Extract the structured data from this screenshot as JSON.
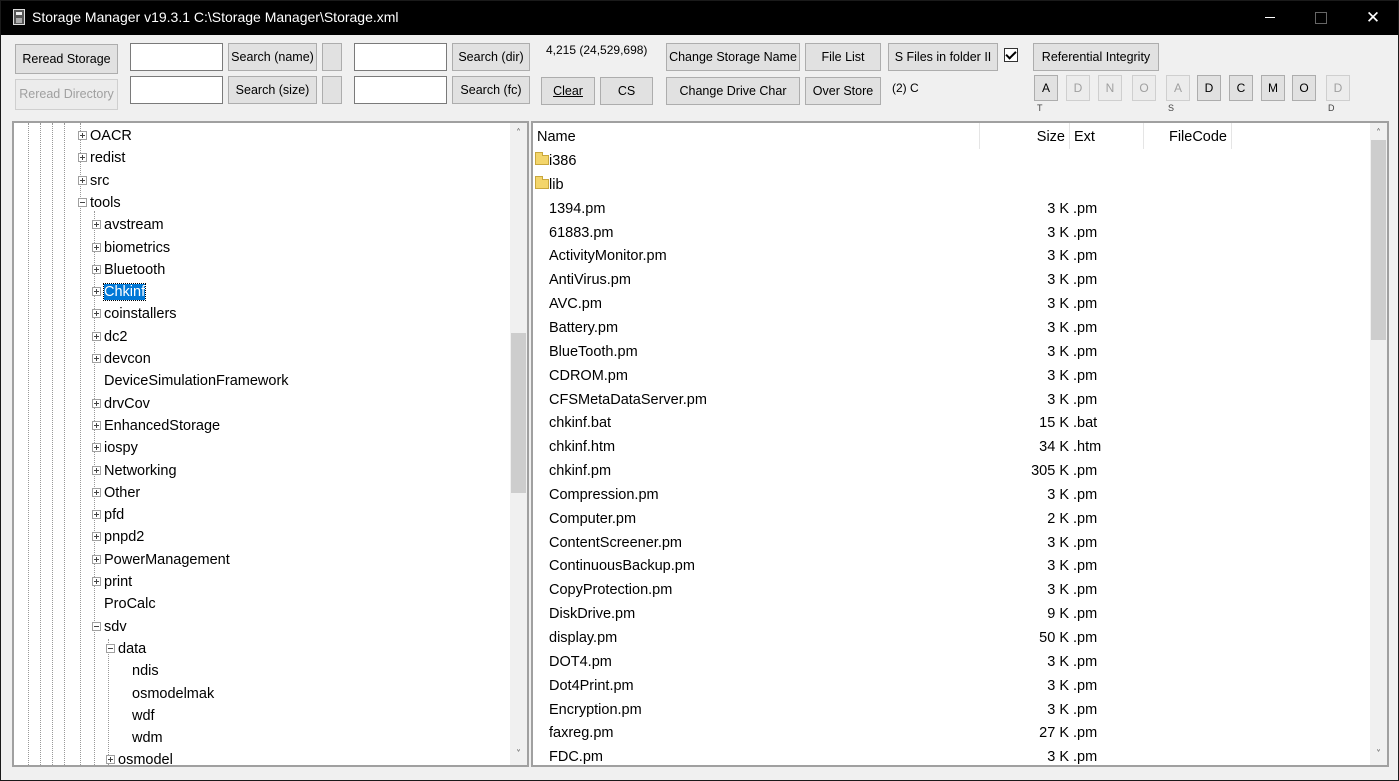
{
  "window": {
    "title": "Storage Manager v19.3.1  C:\\Storage Manager\\Storage.xml",
    "minimize_icon": "minimize-icon",
    "maximize_icon": "maximize-icon",
    "close_glyph": "✕"
  },
  "toolbar": {
    "reread_storage": "Reread Storage",
    "reread_directory": "Reread Directory",
    "search_name": "Search (name)",
    "search_size": "Search (size)",
    "search_dir": "Search (dir)",
    "search_fc": "Search (fc)",
    "count": "4,215 (24,529,698)",
    "clear": "Clear",
    "cs": "CS",
    "change_storage_name": "Change Storage Name",
    "change_drive_char": "Change Drive Char",
    "file_list": "File List",
    "over_store": "Over Store",
    "s_files_in_folder": "S Files in folder II",
    "s_files_checked": true,
    "drive_info": "(2) C",
    "referential_integrity": "Referential Integrity",
    "filter_buttons": [
      "A",
      "D",
      "N",
      "O",
      "A",
      "D",
      "C",
      "M",
      "O",
      "D"
    ],
    "filter_disabled": [
      false,
      true,
      true,
      true,
      true,
      false,
      false,
      false,
      false,
      true
    ],
    "filter_captions": [
      "T",
      "S",
      "D"
    ]
  },
  "tree": {
    "nodes": [
      {
        "label": "OACR",
        "level": 0,
        "expander": "plus"
      },
      {
        "label": "redist",
        "level": 0,
        "expander": "plus"
      },
      {
        "label": "src",
        "level": 0,
        "expander": "plus"
      },
      {
        "label": "tools",
        "level": 0,
        "expander": "minus"
      },
      {
        "label": "avstream",
        "level": 1,
        "expander": "plus"
      },
      {
        "label": "biometrics",
        "level": 1,
        "expander": "plus"
      },
      {
        "label": "Bluetooth",
        "level": 1,
        "expander": "plus"
      },
      {
        "label": "Chkinf",
        "level": 1,
        "expander": "plus",
        "selected": true
      },
      {
        "label": "coinstallers",
        "level": 1,
        "expander": "plus"
      },
      {
        "label": "dc2",
        "level": 1,
        "expander": "plus"
      },
      {
        "label": "devcon",
        "level": 1,
        "expander": "plus"
      },
      {
        "label": "DeviceSimulationFramework",
        "level": 1,
        "expander": "none"
      },
      {
        "label": "drvCov",
        "level": 1,
        "expander": "plus"
      },
      {
        "label": "EnhancedStorage",
        "level": 1,
        "expander": "plus"
      },
      {
        "label": "iospy",
        "level": 1,
        "expander": "plus"
      },
      {
        "label": "Networking",
        "level": 1,
        "expander": "plus"
      },
      {
        "label": "Other",
        "level": 1,
        "expander": "plus"
      },
      {
        "label": "pfd",
        "level": 1,
        "expander": "plus"
      },
      {
        "label": "pnpd2",
        "level": 1,
        "expander": "plus"
      },
      {
        "label": "PowerManagement",
        "level": 1,
        "expander": "plus"
      },
      {
        "label": "print",
        "level": 1,
        "expander": "plus"
      },
      {
        "label": "ProCalc",
        "level": 1,
        "expander": "none"
      },
      {
        "label": "sdv",
        "level": 1,
        "expander": "minus"
      },
      {
        "label": "data",
        "level": 2,
        "expander": "minus"
      },
      {
        "label": "ndis",
        "level": 3,
        "expander": "none"
      },
      {
        "label": "osmodelmak",
        "level": 3,
        "expander": "none"
      },
      {
        "label": "wdf",
        "level": 3,
        "expander": "none"
      },
      {
        "label": "wdm",
        "level": 3,
        "expander": "none"
      },
      {
        "label": "osmodel",
        "level": 2,
        "expander": "plus"
      }
    ],
    "scroll_position": 0.43
  },
  "list": {
    "columns": {
      "name": "Name",
      "size": "Size",
      "ext": "Ext",
      "filecode": "FileCode"
    },
    "rows": [
      {
        "name": "i386",
        "size": "",
        "ext": "",
        "folder": true
      },
      {
        "name": "lib",
        "size": "",
        "ext": "",
        "folder": true
      },
      {
        "name": "1394.pm",
        "size": "3 K",
        "ext": ".pm"
      },
      {
        "name": "61883.pm",
        "size": "3 K",
        "ext": ".pm"
      },
      {
        "name": "ActivityMonitor.pm",
        "size": "3 K",
        "ext": ".pm"
      },
      {
        "name": "AntiVirus.pm",
        "size": "3 K",
        "ext": ".pm"
      },
      {
        "name": "AVC.pm",
        "size": "3 K",
        "ext": ".pm"
      },
      {
        "name": "Battery.pm",
        "size": "3 K",
        "ext": ".pm"
      },
      {
        "name": "BlueTooth.pm",
        "size": "3 K",
        "ext": ".pm"
      },
      {
        "name": "CDROM.pm",
        "size": "3 K",
        "ext": ".pm"
      },
      {
        "name": "CFSMetaDataServer.pm",
        "size": "3 K",
        "ext": ".pm"
      },
      {
        "name": "chkinf.bat",
        "size": "15 K",
        "ext": ".bat"
      },
      {
        "name": "chkinf.htm",
        "size": "34 K",
        "ext": ".htm"
      },
      {
        "name": "chkinf.pm",
        "size": "305 K",
        "ext": ".pm"
      },
      {
        "name": "Compression.pm",
        "size": "3 K",
        "ext": ".pm"
      },
      {
        "name": "Computer.pm",
        "size": "2 K",
        "ext": ".pm"
      },
      {
        "name": "ContentScreener.pm",
        "size": "3 K",
        "ext": ".pm"
      },
      {
        "name": "ContinuousBackup.pm",
        "size": "3 K",
        "ext": ".pm"
      },
      {
        "name": "CopyProtection.pm",
        "size": "3 K",
        "ext": ".pm"
      },
      {
        "name": "DiskDrive.pm",
        "size": "9 K",
        "ext": ".pm"
      },
      {
        "name": "display.pm",
        "size": "50 K",
        "ext": ".pm"
      },
      {
        "name": "DOT4.pm",
        "size": "3 K",
        "ext": ".pm"
      },
      {
        "name": "Dot4Print.pm",
        "size": "3 K",
        "ext": ".pm"
      },
      {
        "name": "Encryption.pm",
        "size": "3 K",
        "ext": ".pm"
      },
      {
        "name": "faxreg.pm",
        "size": "27 K",
        "ext": ".pm"
      },
      {
        "name": "FDC.pm",
        "size": "3 K",
        "ext": ".pm"
      }
    ],
    "scroll_position": 0.0
  }
}
